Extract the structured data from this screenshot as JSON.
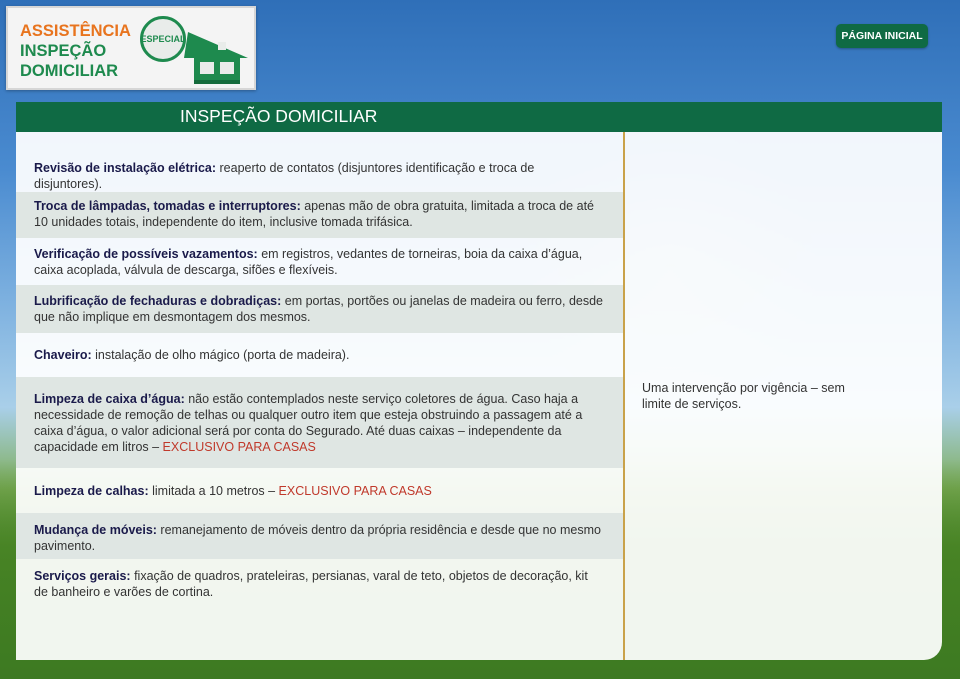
{
  "logo": {
    "line1": "ASSISTÊNCIA",
    "line2": "INSPEÇÃO",
    "line3": "DOMICILIAR",
    "badge": "ESPECIAL"
  },
  "header": {
    "home_button": "PÁGINA INICIAL"
  },
  "panel": {
    "title": "INSPEÇÃO DOMICILIAR",
    "items": [
      {
        "label": "Revisão de instalação elétrica:",
        "text": " reaperto de contatos (disjuntores identificação e troca de disjuntores).",
        "excl": ""
      },
      {
        "label": "Troca de lâmpadas, tomadas e interruptores:",
        "text": " apenas mão de obra gratuita, limitada a troca de até 10 unidades totais, independente do item, inclusive tomada trifásica.",
        "excl": ""
      },
      {
        "label": "Verificação de possíveis vazamentos:",
        "text": " em registros, vedantes de torneiras, boia da caixa d’água, caixa acoplada, válvula de descarga, sifões e flexíveis.",
        "excl": ""
      },
      {
        "label": "Lubrificação de fechaduras e dobradiças:",
        "text": " em portas, portões ou janelas de madeira ou ferro, desde que não implique em desmontagem dos mesmos.",
        "excl": ""
      },
      {
        "label": "Chaveiro:",
        "text": " instalação de olho mágico (porta de madeira).",
        "excl": ""
      },
      {
        "label": "Limpeza de caixa d’água:",
        "text": " não estão contemplados neste serviço coletores de água. Caso haja a necessidade de remoção de telhas ou qualquer outro item que esteja obstruindo a passagem até a caixa d’água, o valor adicional será por conta do Segurado. Até duas caixas – independente da capacidade em litros – ",
        "excl": "EXCLUSIVO PARA CASAS"
      },
      {
        "label": "Limpeza de calhas:",
        "text": " limitada a 10 metros – ",
        "excl": "EXCLUSIVO PARA CASAS"
      },
      {
        "label": "Mudança de móveis:",
        "text": " remanejamento de móveis dentro da própria residência e desde que no mesmo pavimento.",
        "excl": ""
      },
      {
        "label": "Serviços gerais:",
        "text": " fixação de quadros, prateleiras, persianas, varal de teto, objetos de decoração, kit de banheiro e varões de cortina.",
        "excl": ""
      }
    ],
    "side_note": "Uma intervenção por vigência – sem limite de serviços."
  },
  "colors": {
    "brand_green": "#0f6a44",
    "brand_orange": "#e8741e",
    "divider_gold": "#c9a24a",
    "exclusive_red": "#c0392b"
  }
}
